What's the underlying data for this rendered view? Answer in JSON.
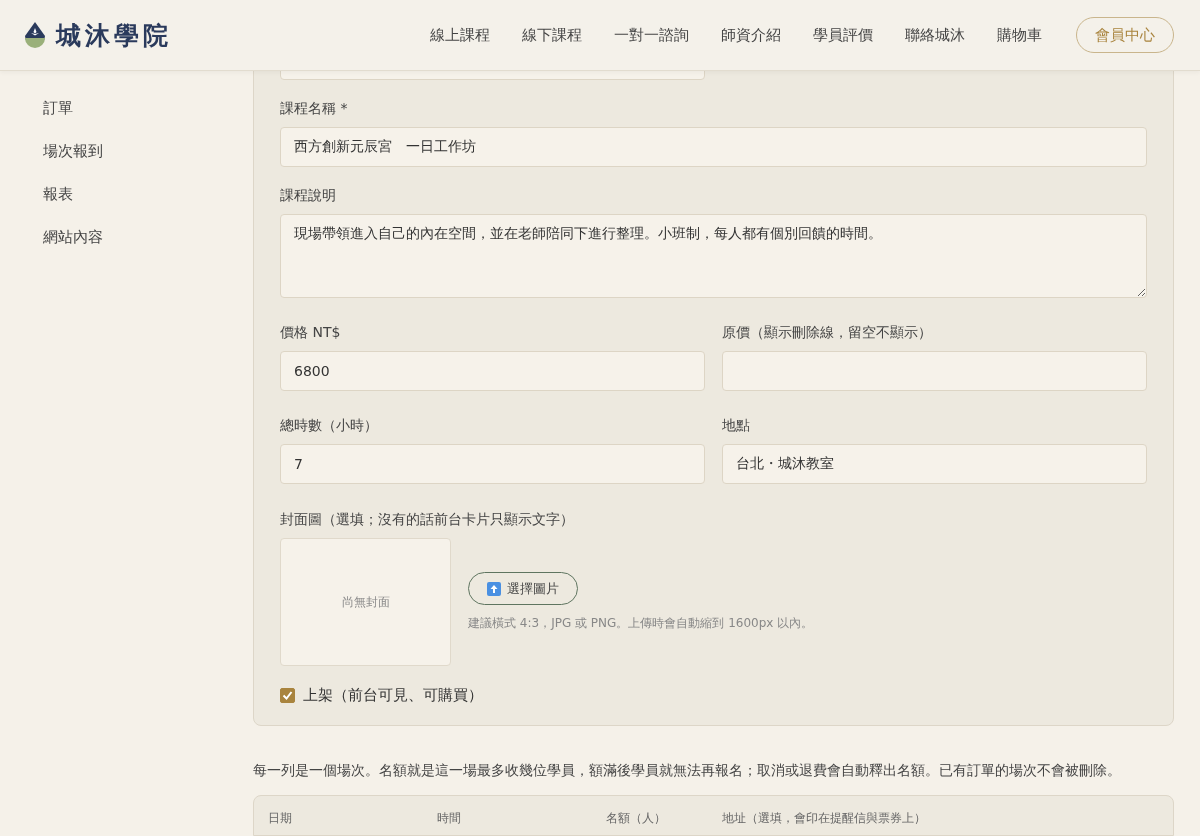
{
  "header": {
    "brand": "城沐學院",
    "nav": [
      {
        "label": "線上課程"
      },
      {
        "label": "線下課程"
      },
      {
        "label": "一對一諮詢"
      },
      {
        "label": "師資介紹"
      },
      {
        "label": "學員評價"
      },
      {
        "label": "聯絡城沐"
      },
      {
        "label": "購物車"
      }
    ],
    "member_button": "會員中心"
  },
  "sidebar": {
    "items": [
      {
        "label": "訂單"
      },
      {
        "label": "場次報到"
      },
      {
        "label": "報表"
      },
      {
        "label": "網站內容"
      }
    ]
  },
  "form": {
    "fields": [
      {
        "kind": "text",
        "label": "課程名稱 *",
        "value": "西方創新元辰宮　一日工作坊"
      },
      {
        "kind": "textarea",
        "label": "課程說明",
        "value": "現場帶領進入自己的內在空間，並在老師陪同下進行整理。小班制，每人都有個別回饋的時間。"
      }
    ],
    "pairs": [
      [
        {
          "label": "價格 NT$",
          "value": "6800"
        },
        {
          "label": "原價（顯示刪除線，留空不顯示）"
        }
      ],
      [
        {
          "label": "總時數（小時）",
          "value": "7"
        },
        {
          "label": "地點",
          "value": "台北・城沐教室"
        }
      ]
    ],
    "cover": {
      "label": "封面圖（選填；沒有的話前台卡片只顯示文字）",
      "placeholder": "尚無封面",
      "button": "選擇圖片",
      "hint": "建議橫式 4:3，JPG 或 PNG。上傳時會自動縮到 1600px 以內。"
    },
    "published": {
      "label": "上架（前台可見、可購買）",
      "checked": true
    }
  },
  "sessions": {
    "note": "每一列是一個場次。名額就是這一場最多收幾位學員，額滿後學員就無法再報名；取消或退費會自動釋出名額。已有訂單的場次不會被刪除。",
    "columns": [
      "日期",
      "時間",
      "名額（人）",
      "地址（選填，會印在提醒信與票券上）"
    ]
  }
}
